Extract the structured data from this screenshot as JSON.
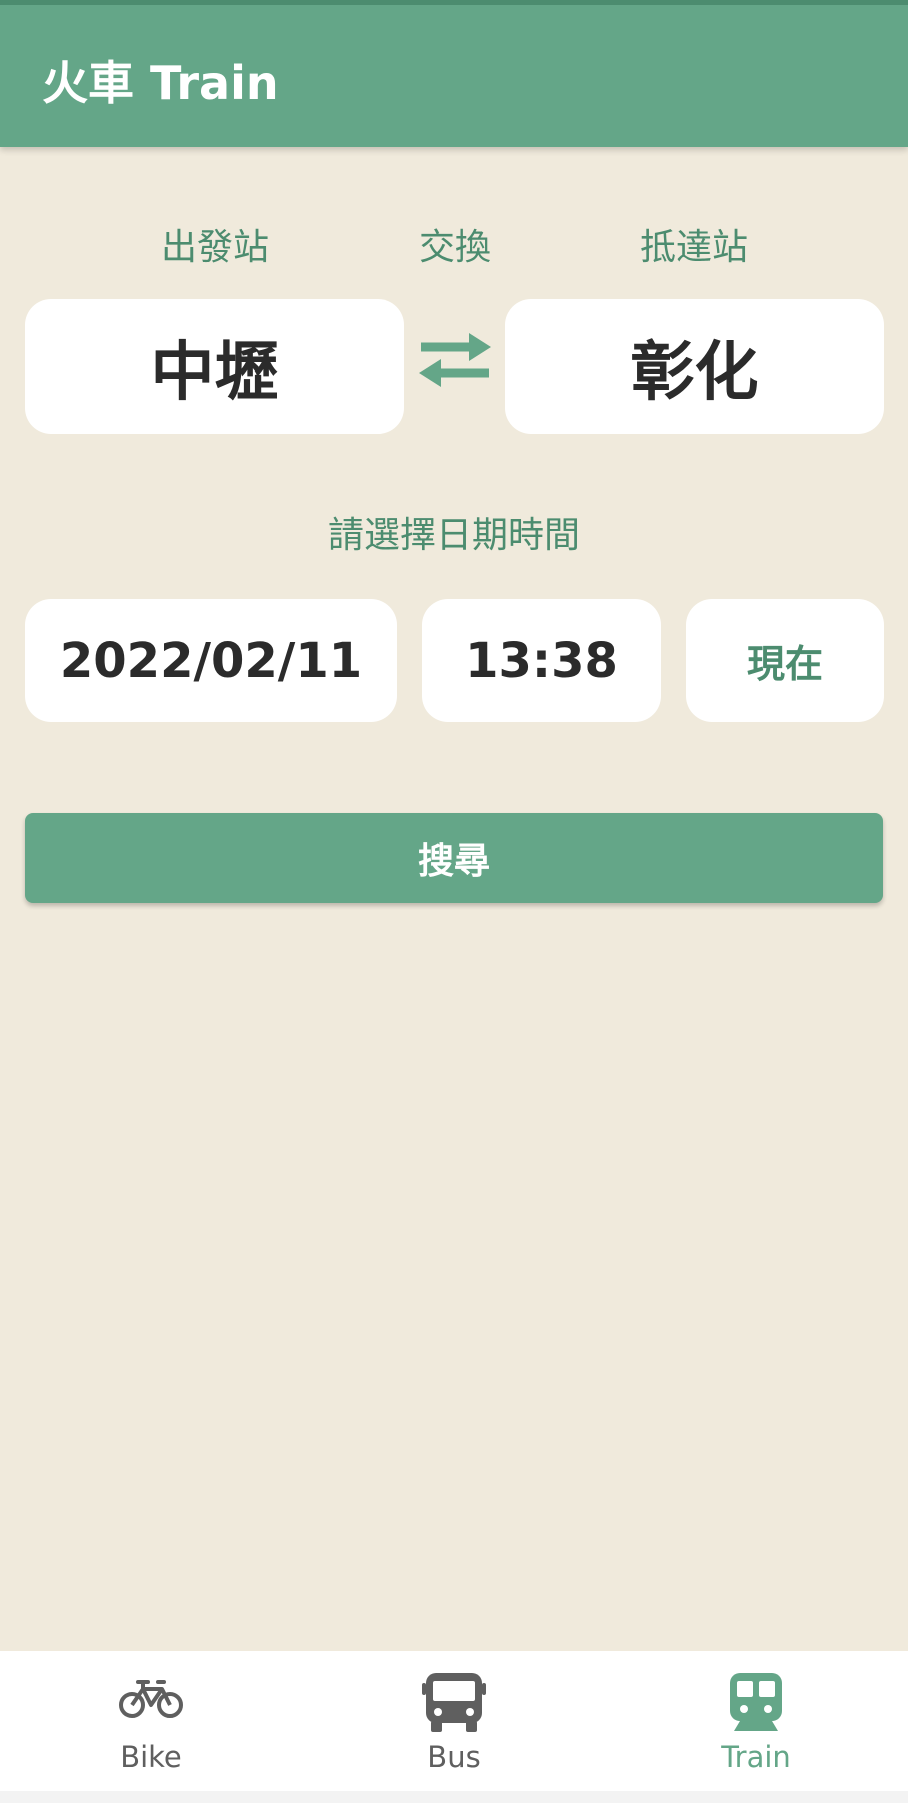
{
  "header": {
    "title": "火車 Train"
  },
  "labels": {
    "departure": "出發站",
    "swap": "交換",
    "arrival": "抵達站",
    "choose_datetime": "請選擇日期時間"
  },
  "stations": {
    "departure": "中壢",
    "arrival": "彰化"
  },
  "datetime": {
    "date": "2022/02/11",
    "time": "13:38",
    "now_button": "現在"
  },
  "search_button": "搜尋",
  "bottom_nav": {
    "items": [
      {
        "label": "Bike",
        "icon": "bike-icon",
        "active": false
      },
      {
        "label": "Bus",
        "icon": "bus-icon",
        "active": false
      },
      {
        "label": "Train",
        "icon": "train-icon",
        "active": true
      }
    ]
  },
  "colors": {
    "accent": "#64A688",
    "accent_text": "#4C8C6F",
    "background": "#F0EADC",
    "inactive_nav": "#5F5F5F"
  }
}
